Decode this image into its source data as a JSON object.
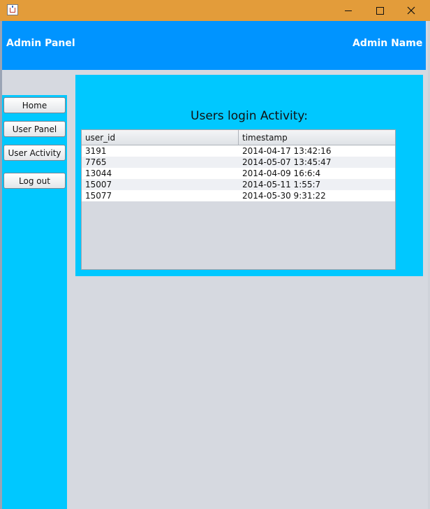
{
  "window": {
    "icon": "java-cup-icon",
    "controls": [
      "minimize-icon",
      "maximize-icon",
      "close-icon"
    ]
  },
  "header": {
    "title": "Admin Panel",
    "user_name": "Admin Name"
  },
  "sidebar": {
    "items": [
      {
        "label": "Home"
      },
      {
        "label": "User Panel"
      },
      {
        "label": "User Activity"
      },
      {
        "label": "Log out"
      }
    ]
  },
  "main": {
    "title": "Users login Activity:",
    "table": {
      "columns": [
        "user_id",
        "timestamp"
      ],
      "rows": [
        [
          "3191",
          "2014-04-17 13:42:16"
        ],
        [
          "7765",
          "2014-05-07 13:45:47"
        ],
        [
          "13044",
          "2014-04-09 16:6:4"
        ],
        [
          "15007",
          "2014-05-11 1:55:7"
        ],
        [
          "15077",
          "2014-05-30 9:31:22"
        ]
      ]
    }
  },
  "colors": {
    "title_bar": "#e39c3a",
    "header": "#0094ff",
    "panel": "#00c8ff",
    "background": "#d6d9e0"
  }
}
